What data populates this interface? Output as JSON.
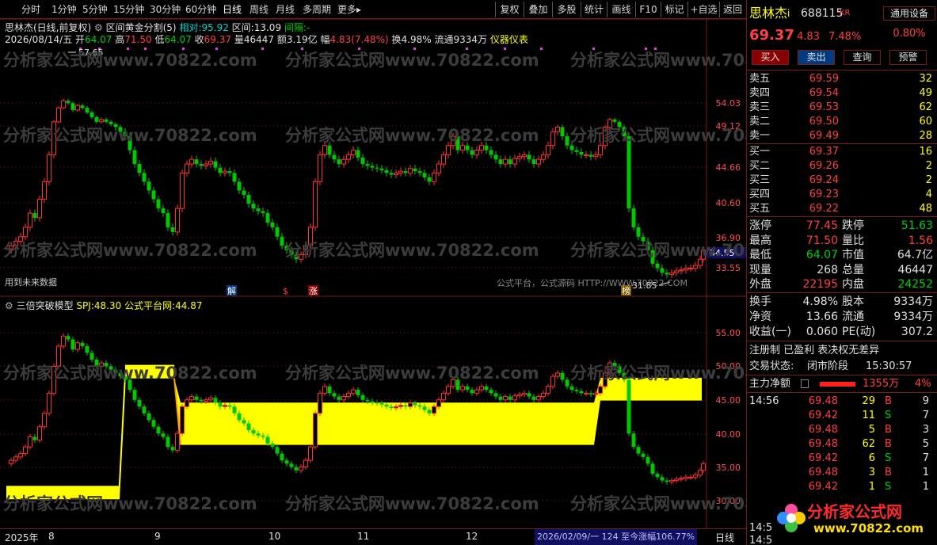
{
  "toolbar": {
    "periods": [
      "分时",
      "1分钟",
      "5分钟",
      "15分钟",
      "30分钟",
      "60分钟",
      "日线",
      "周线",
      "月线",
      "多周期",
      "更多▸"
    ],
    "right": [
      "复权",
      "叠加",
      "多股",
      "统计",
      "画线",
      "F10",
      "标记",
      "+自选",
      "返回"
    ]
  },
  "kline": {
    "title": "思林杰(日线,前复权)",
    "indicator_name": "区间黄金分割(5)",
    "relative_label": "相对:",
    "relative_value": "95.92",
    "interval_label": "区间:",
    "interval_value": "13.09",
    "gap_label": "间隔:",
    "gap_value": "-",
    "date": "2026/08/14/五",
    "open_label": "开",
    "open": "64.07",
    "high_label": "高",
    "high": "71.50",
    "low_label": "低",
    "low": "64.07",
    "close_label": "收",
    "close": "69.37",
    "vol_label": "量",
    "vol": "46447",
    "amount_label": "额",
    "amount": "3.19亿",
    "amp_label": "幅",
    "amp": "4.83(7.48%)",
    "turnover_label": "换",
    "turnover": "4.98%",
    "float_label": "流通",
    "float": "9334万",
    "dashboard": "仪器仪表",
    "future_data": "用到未来数据",
    "high_mark": "57.65",
    "low_mark": "31.85",
    "current_price": "34.55",
    "y_ticks": [
      "54.03",
      "49.12",
      "44.66",
      "40.60",
      "36.90",
      "33.55"
    ],
    "footer_ad": "公式平台，公式源码 HTTP://WWW.70822.COM",
    "event_tags": [
      "解",
      "$",
      "涨",
      "榜"
    ]
  },
  "indicator": {
    "name": "三倍突破模型",
    "spj_label": "SPJ:",
    "spj_value": "48.30",
    "platform_label": "公式平台网:",
    "platform_value": "44.87",
    "y_ticks": [
      "55.00",
      "50.00",
      "45.00",
      "40.00",
      "35.00",
      "30.00"
    ]
  },
  "x_axis": {
    "labels": [
      "2025年",
      "8",
      "9",
      "10",
      "11",
      "12"
    ],
    "status": "2026/02/09/一 124 至今涨幅106.77%",
    "period": "日线"
  },
  "watermark": "分析家公式网www.70822.com",
  "stock": {
    "name": "思林杰",
    "code": "688115",
    "badge": "KR",
    "price": "69.37",
    "change": "4.83",
    "change_pct": "7.48%",
    "device": "通用设备",
    "device_pct": "0.80%"
  },
  "actions": [
    "买入",
    "卖出",
    "查询",
    "预警"
  ],
  "sell": [
    {
      "label": "卖五",
      "price": "69.59",
      "vol": "32"
    },
    {
      "label": "卖四",
      "price": "69.54",
      "vol": "49"
    },
    {
      "label": "卖三",
      "price": "69.53",
      "vol": "62"
    },
    {
      "label": "卖二",
      "price": "69.50",
      "vol": "60"
    },
    {
      "label": "卖一",
      "price": "69.49",
      "vol": "28"
    }
  ],
  "buy": [
    {
      "label": "买一",
      "price": "69.37",
      "vol": "16"
    },
    {
      "label": "买二",
      "price": "69.26",
      "vol": "2"
    },
    {
      "label": "买三",
      "price": "69.24",
      "vol": "2"
    },
    {
      "label": "买四",
      "price": "69.23",
      "vol": "4"
    },
    {
      "label": "买五",
      "price": "69.22",
      "vol": "48"
    }
  ],
  "stats": [
    {
      "l1": "涨停",
      "v1": "77.45",
      "l2": "跌停",
      "v2": "51.63",
      "c1": "#ff4040",
      "c2": "#00d000"
    },
    {
      "l1": "最高",
      "v1": "71.50",
      "l2": "量比",
      "v2": "1.56",
      "c1": "#ff4040",
      "c2": "#ff4040"
    },
    {
      "l1": "最低",
      "v1": "64.07",
      "l2": "市值",
      "v2": "64.7亿",
      "c1": "#00d000",
      "c2": "#e0e0e0"
    },
    {
      "l1": "现量",
      "v1": "268",
      "l2": "总量",
      "v2": "46447",
      "c1": "#e0e0e0",
      "c2": "#e0e0e0"
    },
    {
      "l1": "外盘",
      "v1": "22195",
      "l2": "内盘",
      "v2": "24252",
      "c1": "#ff4040",
      "c2": "#00d000"
    }
  ],
  "stats2": [
    {
      "l1": "换手",
      "v1": "4.98%",
      "l2": "股本",
      "v2": "9334万"
    },
    {
      "l1": "净资",
      "v1": "13.66",
      "l2": "流通",
      "v2": "9334万"
    },
    {
      "l1": "收益(一)",
      "v1": "0.060",
      "l2": "PE(动)",
      "v2": "307.2"
    }
  ],
  "notes": {
    "register": "注册制 已盈利 表决权无差异",
    "trade_state_label": "交易状态:",
    "trade_state": "闭市阶段",
    "trade_time": "15:30:57",
    "main_flow_label": "主力净额",
    "main_flow_value": "1355万",
    "main_flow_pct": "4%"
  },
  "ticks": [
    {
      "time": "14:56",
      "price": "69.48",
      "vol": "29",
      "bs": "B",
      "n": "9"
    },
    {
      "time": "",
      "price": "69.42",
      "vol": "11",
      "bs": "S",
      "n": "7"
    },
    {
      "time": "",
      "price": "69.48",
      "vol": "5",
      "bs": "B",
      "n": "3"
    },
    {
      "time": "",
      "price": "69.48",
      "vol": "62",
      "bs": "B",
      "n": "5"
    },
    {
      "time": "",
      "price": "69.42",
      "vol": "6",
      "bs": "S",
      "n": "7"
    },
    {
      "time": "",
      "price": "69.48",
      "vol": "3",
      "bs": "B",
      "n": "1"
    },
    {
      "time": "",
      "price": "69.42",
      "vol": "1",
      "bs": "S",
      "n": "1"
    }
  ],
  "bottom_times": [
    "14:5",
    "14:5"
  ],
  "logo": {
    "text": "分析家公式网",
    "url": "www.70822.com"
  },
  "colors": {
    "up": "#ff3030",
    "down": "#00c800",
    "yellow": "#ffff00",
    "grid": "#7a1a1a",
    "accent": "#00d0d0"
  }
}
